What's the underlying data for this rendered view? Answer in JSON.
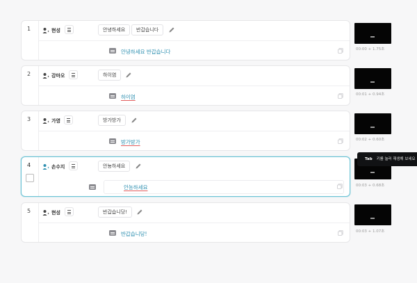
{
  "segments": [
    {
      "number": "1",
      "speaker": "현성",
      "chips": [
        "안녕하세요",
        "반갑습니다"
      ],
      "transcript": "안녕하세요 반갑습니다",
      "time": "00:00 + 1.75초",
      "underline": false
    },
    {
      "number": "2",
      "speaker": "강마오",
      "chips": [
        "하이염"
      ],
      "transcript": "하이염",
      "time": "00:01 + 0.94초",
      "underline": true
    },
    {
      "number": "3",
      "speaker": "가영",
      "chips": [
        "방가방가"
      ],
      "transcript": "방가방가",
      "time": "00:02 + 0.60초",
      "underline": true
    },
    {
      "number": "4",
      "speaker": "손수지",
      "chips": [
        "안뇽하세요"
      ],
      "transcript": "안뇽하세요",
      "time": "00:03 + 0.68초",
      "underline": true
    },
    {
      "number": "5",
      "speaker": "현성",
      "chips": [
        "반갑습니당!"
      ],
      "transcript": "반갑습니당!",
      "time": "00:03 + 1.07초",
      "underline": true
    }
  ],
  "tooltip": {
    "key": "Tab",
    "text": "키를 눌러 재생해 보세요"
  },
  "colors": {
    "accent": "#2d8fb0",
    "active_border": "#6cc3d5",
    "error_underline": "#e25c5c"
  }
}
